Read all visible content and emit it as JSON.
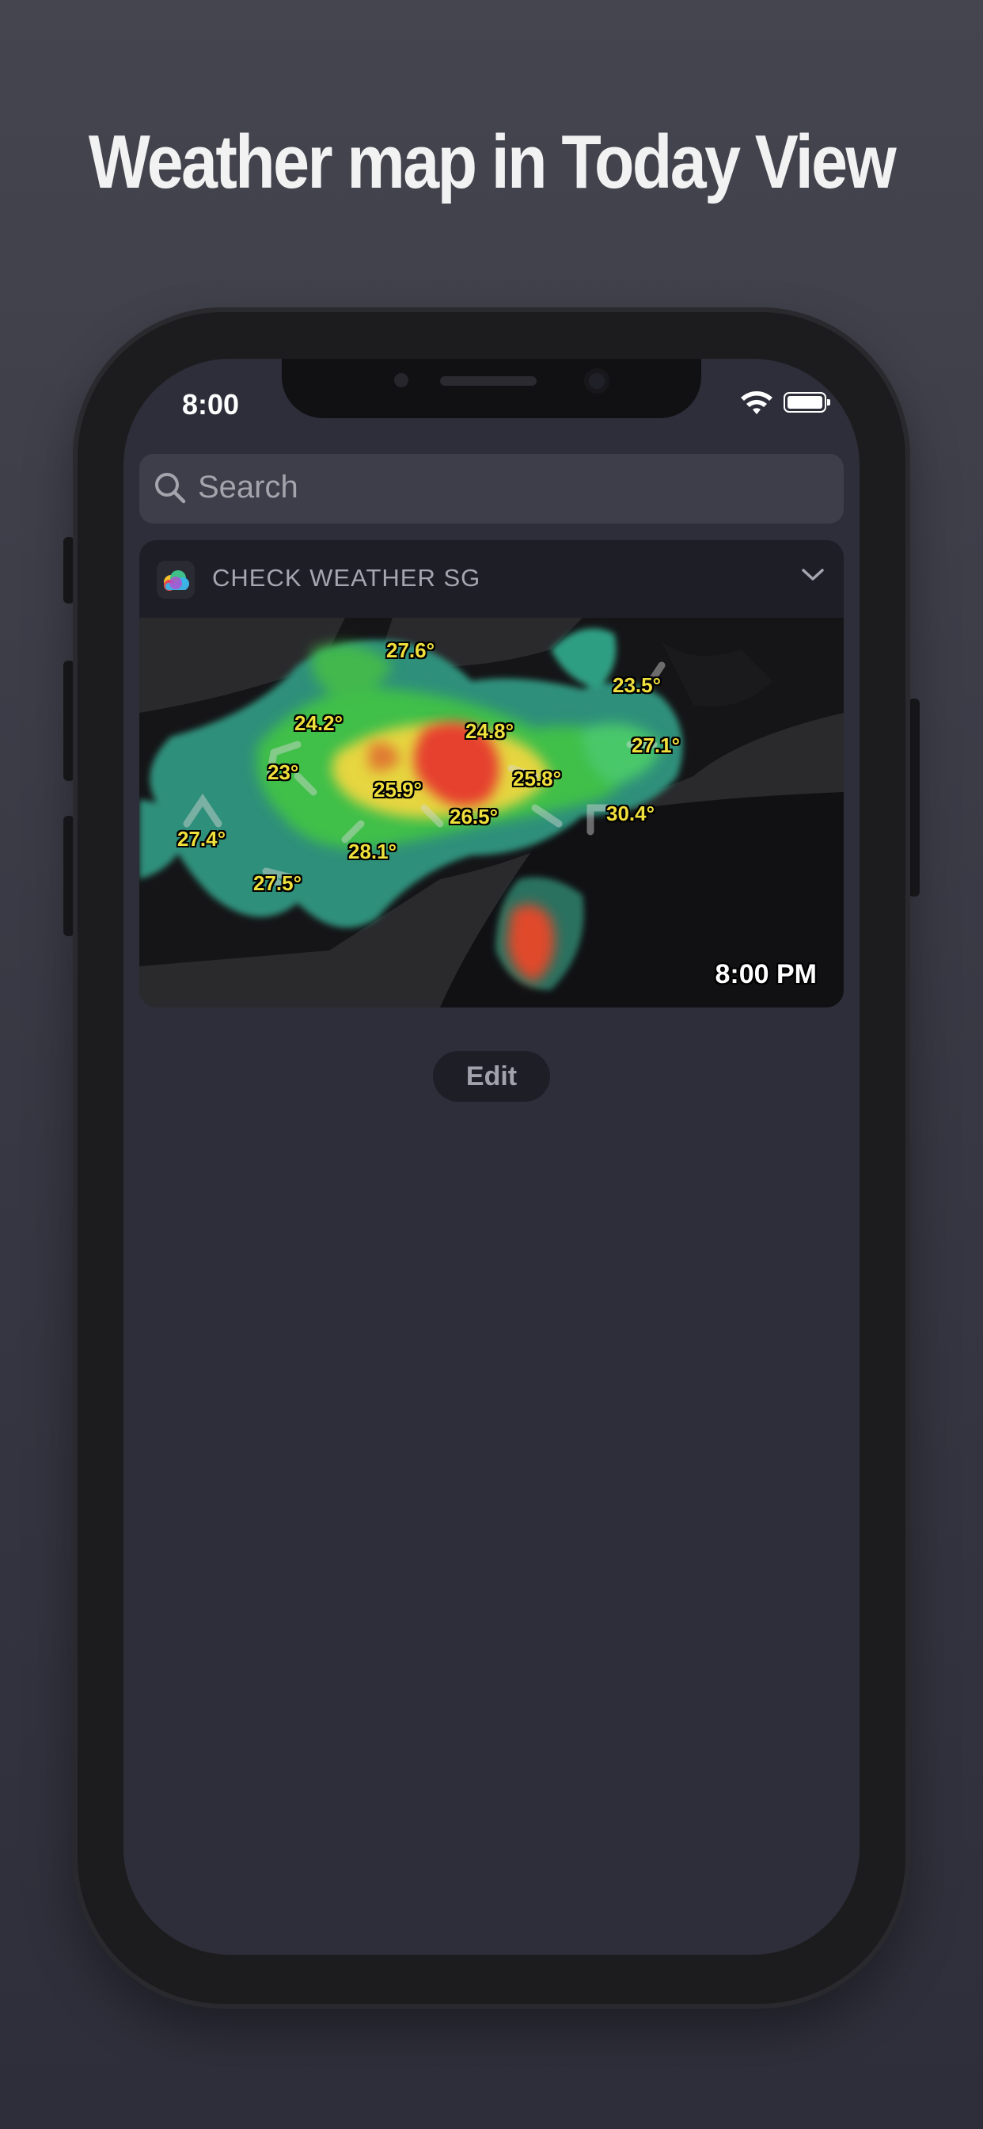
{
  "headline": "Weather map in Today View",
  "status_bar": {
    "time": "8:00"
  },
  "search": {
    "placeholder": "Search"
  },
  "widget": {
    "app_name": "CHECK WEATHER SG",
    "map": {
      "timestamp": "8:00 PM",
      "temperatures": [
        "27.6°",
        "23.5°",
        "24.2°",
        "24.8°",
        "27.1°",
        "23°",
        "25.9°",
        "25.8°",
        "26.5°",
        "30.4°",
        "27.4°",
        "28.1°",
        "27.5°"
      ]
    }
  },
  "edit_label": "Edit"
}
